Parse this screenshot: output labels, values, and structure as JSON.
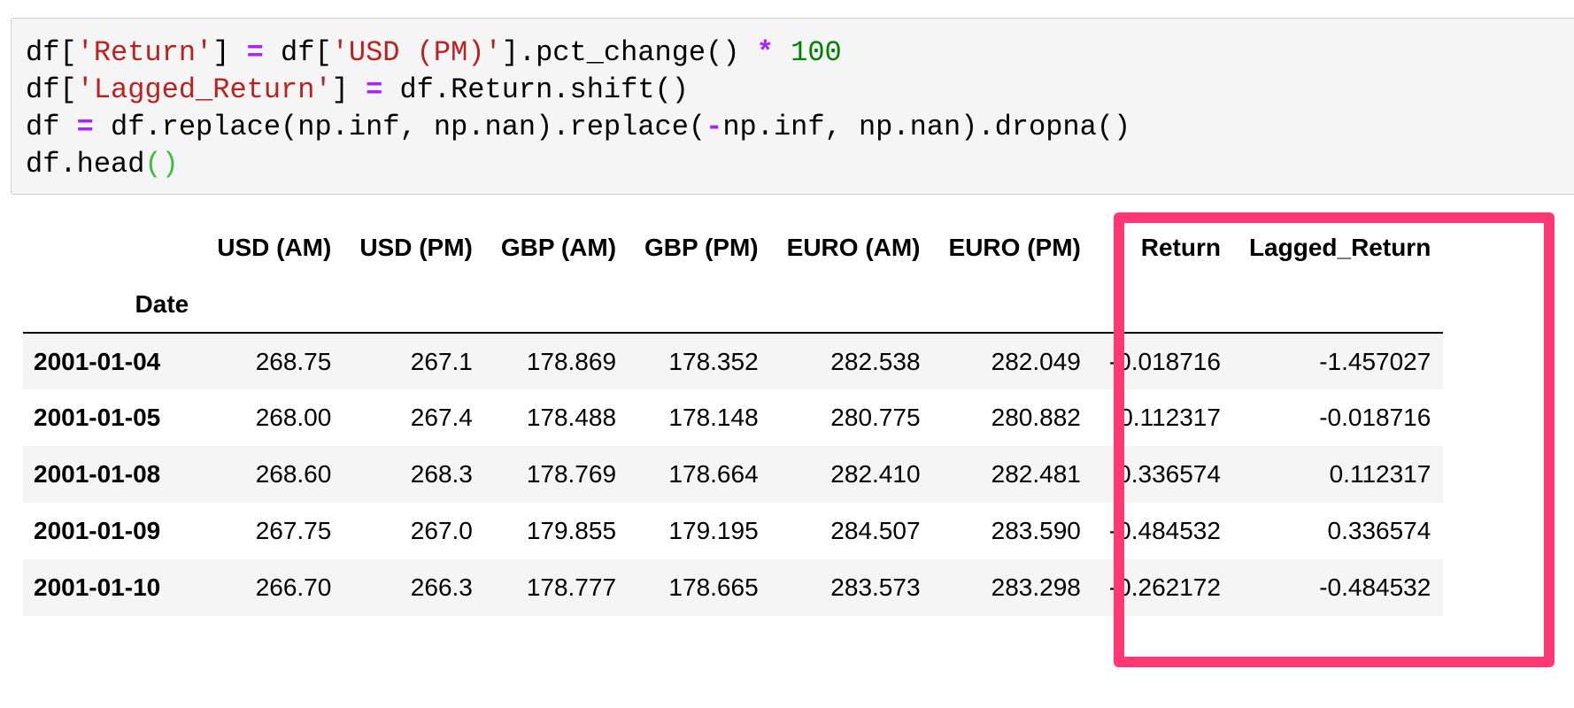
{
  "code_cell": {
    "lines": [
      [
        {
          "t": "df[",
          "c": "plain"
        },
        {
          "t": "'Return'",
          "c": "str"
        },
        {
          "t": "] ",
          "c": "plain"
        },
        {
          "t": "=",
          "c": "op"
        },
        {
          "t": " df[",
          "c": "plain"
        },
        {
          "t": "'USD (PM)'",
          "c": "str"
        },
        {
          "t": "].pct_change() ",
          "c": "plain"
        },
        {
          "t": "*",
          "c": "op"
        },
        {
          "t": " ",
          "c": "plain"
        },
        {
          "t": "100",
          "c": "num"
        }
      ],
      [
        {
          "t": "df[",
          "c": "plain"
        },
        {
          "t": "'Lagged_Return'",
          "c": "str"
        },
        {
          "t": "] ",
          "c": "plain"
        },
        {
          "t": "=",
          "c": "op"
        },
        {
          "t": " df.Return.shift()",
          "c": "plain"
        }
      ],
      [
        {
          "t": "df ",
          "c": "plain"
        },
        {
          "t": "=",
          "c": "op"
        },
        {
          "t": " df.replace(np.inf, np.nan).replace(",
          "c": "plain"
        },
        {
          "t": "-",
          "c": "op"
        },
        {
          "t": "np.inf, np.nan).dropna()",
          "c": "plain"
        }
      ],
      [
        {
          "t": "df.head",
          "c": "plain"
        },
        {
          "t": "()",
          "c": "paren"
        }
      ]
    ]
  },
  "output_table": {
    "columns": [
      "USD (AM)",
      "USD (PM)",
      "GBP (AM)",
      "GBP (PM)",
      "EURO (AM)",
      "EURO (PM)",
      "Return",
      "Lagged_Return"
    ],
    "index_name": "Date",
    "rows": [
      {
        "date": "2001-01-04",
        "values": [
          "268.75",
          "267.1",
          "178.869",
          "178.352",
          "282.538",
          "282.049",
          "-0.018716",
          "-1.457027"
        ]
      },
      {
        "date": "2001-01-05",
        "values": [
          "268.00",
          "267.4",
          "178.488",
          "178.148",
          "280.775",
          "280.882",
          "0.112317",
          "-0.018716"
        ]
      },
      {
        "date": "2001-01-08",
        "values": [
          "268.60",
          "268.3",
          "178.769",
          "178.664",
          "282.410",
          "282.481",
          "0.336574",
          "0.112317"
        ]
      },
      {
        "date": "2001-01-09",
        "values": [
          "267.75",
          "267.0",
          "179.855",
          "179.195",
          "284.507",
          "283.590",
          "-0.484532",
          "0.336574"
        ]
      },
      {
        "date": "2001-01-10",
        "values": [
          "266.70",
          "266.3",
          "178.777",
          "178.665",
          "283.573",
          "283.298",
          "-0.262172",
          "-0.484532"
        ]
      }
    ]
  },
  "colors": {
    "code_background": "#f5f5f5",
    "string": "#ba2121",
    "operator": "#aa22ff",
    "number": "#008000",
    "paren": "#3fbb3f",
    "highlight_box": "#ff3875",
    "table_stripe": "#f5f5f5"
  }
}
